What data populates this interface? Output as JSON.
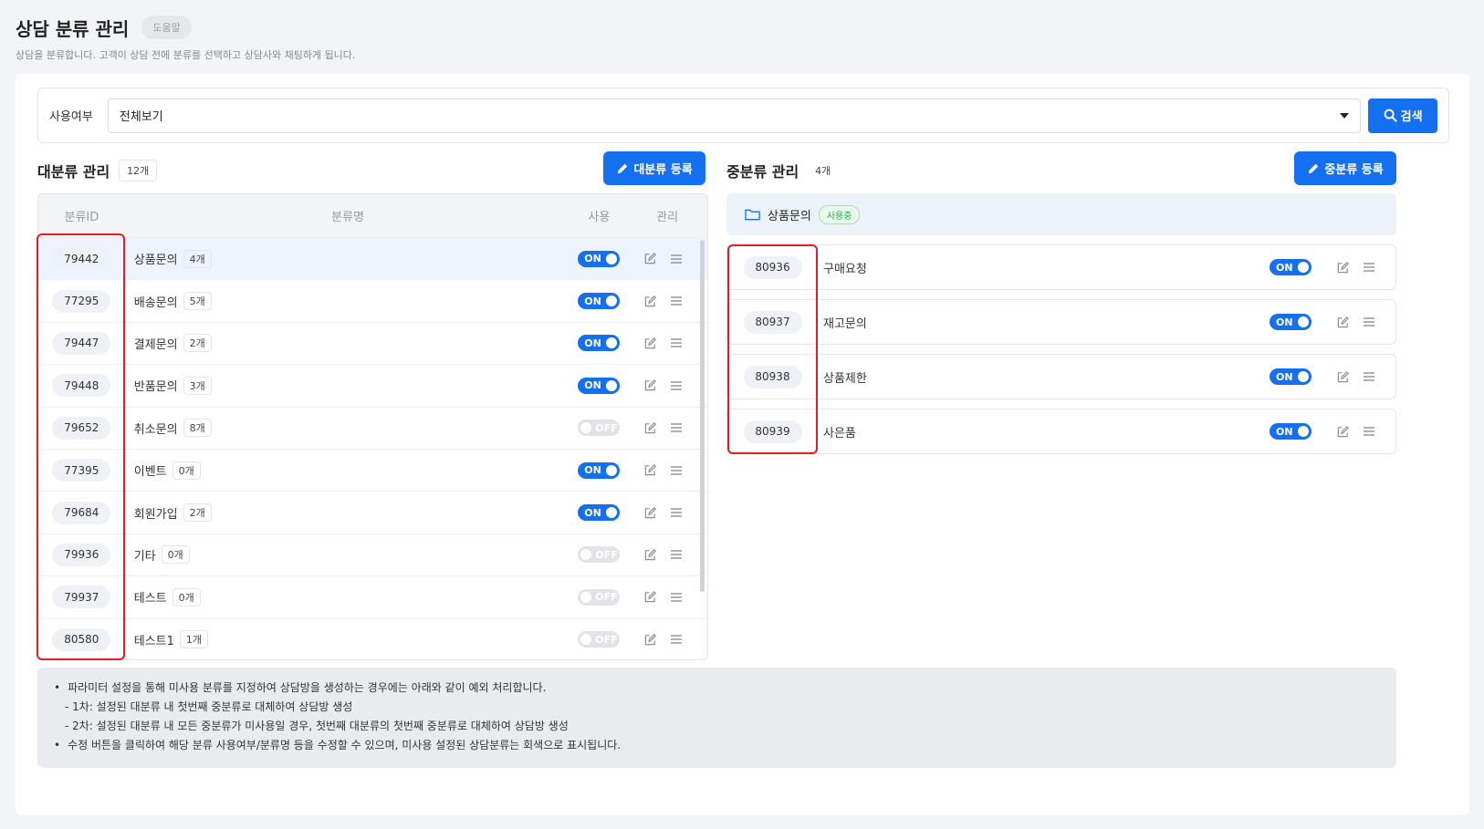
{
  "page": {
    "title": "상담 분류 관리",
    "help_label": "도움말",
    "description": "상담을 분류합니다. 고객이 상담 전에 분류를 선택하고 상담사와 채팅하게 됩니다."
  },
  "filter": {
    "label": "사용여부",
    "selected": "전체보기",
    "search_label": "검색"
  },
  "major": {
    "title": "대분류 관리",
    "count": "12개",
    "register_label": "대분류 등록",
    "columns": [
      "분류ID",
      "분류명",
      "사용",
      "관리"
    ],
    "rows": [
      {
        "id": "79442",
        "name": "상품문의",
        "count": "4개",
        "toggle": "ON"
      },
      {
        "id": "77295",
        "name": "배송문의",
        "count": "5개",
        "toggle": "ON"
      },
      {
        "id": "79447",
        "name": "결제문의",
        "count": "2개",
        "toggle": "ON"
      },
      {
        "id": "79448",
        "name": "반품문의",
        "count": "3개",
        "toggle": "ON"
      },
      {
        "id": "79652",
        "name": "취소문의",
        "count": "8개",
        "toggle": "OFF"
      },
      {
        "id": "77395",
        "name": "이벤트",
        "count": "0개",
        "toggle": "ON"
      },
      {
        "id": "79684",
        "name": "회원가입",
        "count": "2개",
        "toggle": "ON"
      },
      {
        "id": "79936",
        "name": "기타",
        "count": "0개",
        "toggle": "OFF"
      },
      {
        "id": "79937",
        "name": "테스트",
        "count": "0개",
        "toggle": "OFF"
      },
      {
        "id": "80580",
        "name": "테스트1",
        "count": "1개",
        "toggle": "OFF"
      }
    ]
  },
  "minor": {
    "title": "중분류 관리",
    "count": "4개",
    "register_label": "중분류 등록",
    "parent_name": "상품문의",
    "parent_status": "사용중",
    "rows": [
      {
        "id": "80936",
        "name": "구매요청",
        "toggle": "ON"
      },
      {
        "id": "80937",
        "name": "재고문의",
        "toggle": "ON"
      },
      {
        "id": "80938",
        "name": "상품제한",
        "toggle": "ON"
      },
      {
        "id": "80939",
        "name": "사은품",
        "toggle": "ON"
      }
    ]
  },
  "notes": {
    "line1": "파라미터 설정을 통해 미사용 분류를 지정하여 상담방을 생성하는 경우에는 아래와 같이 예외 처리합니다.",
    "line1_sub1": "- 1차: 설정된 대분류 내 첫번째 중분류로 대체하여 상담방 생성",
    "line1_sub2": "- 2차: 설정된 대분류 내 모든 중분류가 미사용일 경우, 첫번째 대분류의 첫번째 중분류로 대체하여 상담방 생성",
    "line2": "수정 버튼을 클릭하여 해당 분류 사용여부/분류명 등을 수정할 수 있으며, 미사용 설정된 상담분류는 회색으로 표시됩니다."
  },
  "colors": {
    "accent": "#1570ef",
    "highlight": "#e02020",
    "badge_green": "#2ea24a"
  },
  "icons": [
    "search-icon",
    "pencil-icon",
    "folder-icon",
    "edit-icon",
    "drag-handle-icon",
    "chevron-down-icon"
  ]
}
